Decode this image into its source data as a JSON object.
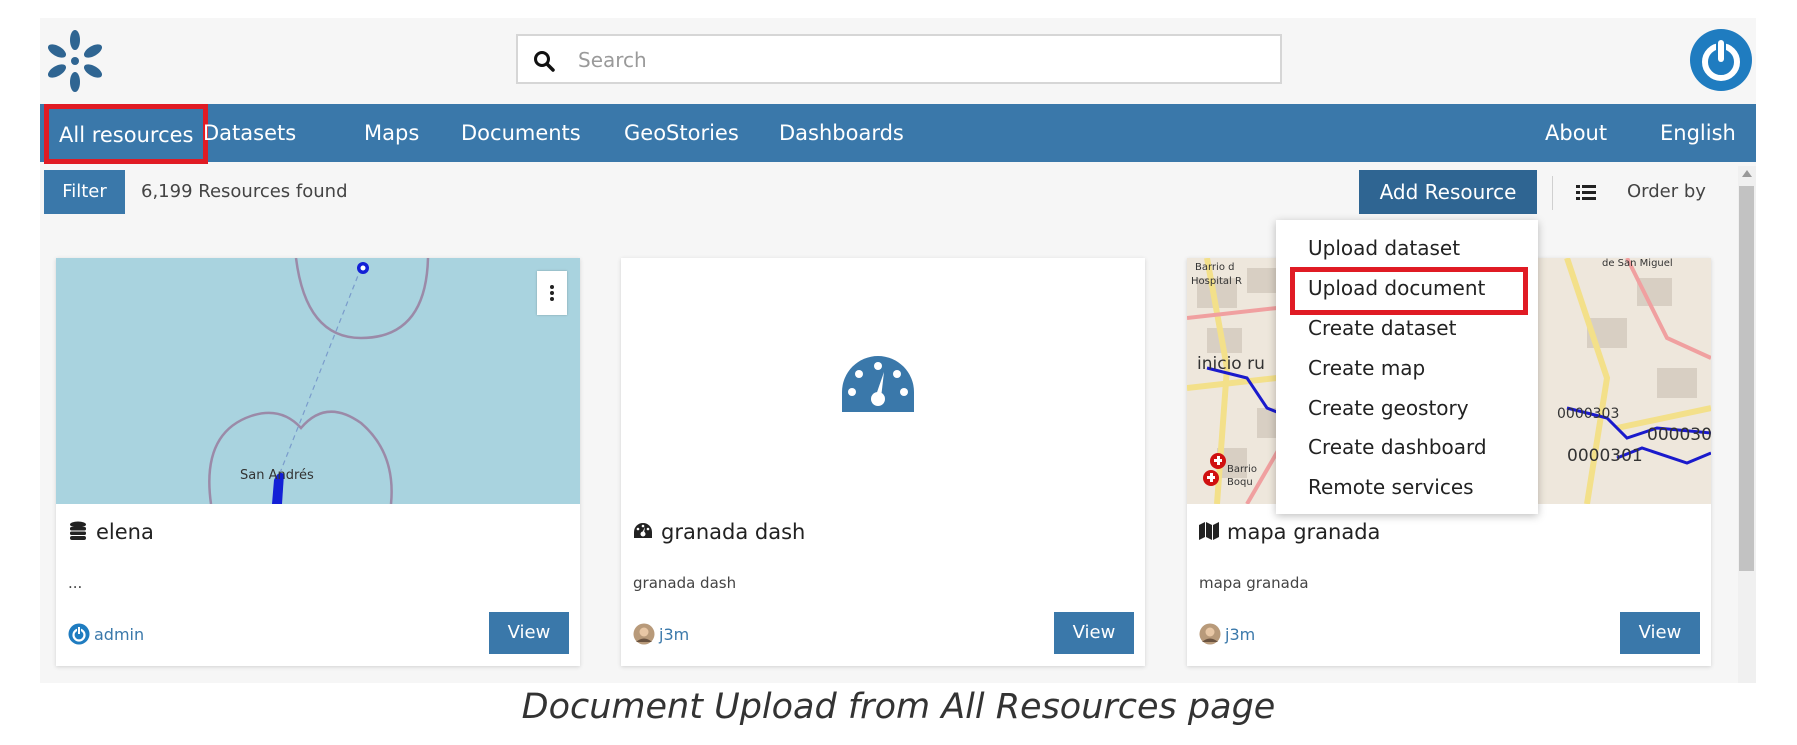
{
  "header": {
    "logo_icon": "geonode-logo-icon",
    "search": {
      "placeholder": "Search",
      "value": ""
    },
    "user_icon": "user-power-icon"
  },
  "nav": {
    "left": [
      "All resources",
      "Datasets",
      "Maps",
      "Documents",
      "GeoStories",
      "Dashboards"
    ],
    "right": [
      "About",
      "English"
    ],
    "active": "All resources"
  },
  "toolbar": {
    "filter_label": "Filter",
    "results_count": "6,199 Resources found",
    "add_resource_label": "Add Resource",
    "view_icon": "list-view-icon",
    "order_by_label": "Order by"
  },
  "add_menu": {
    "items": [
      "Upload dataset",
      "Upload document",
      "Create dataset",
      "Create map",
      "Create geostory",
      "Create dashboard",
      "Remote services"
    ],
    "highlighted": "Upload document"
  },
  "cards": [
    {
      "title": "elena",
      "type_icon": "database-icon",
      "description": "...",
      "owner": "admin",
      "view_label": "View"
    },
    {
      "title": "granada dash",
      "type_icon": "dashboard-icon",
      "description": "granada dash",
      "owner": "j3m",
      "view_label": "View"
    },
    {
      "title": "mapa granada",
      "type_icon": "map-icon",
      "description": "mapa granada",
      "owner": "j3m",
      "view_label": "View"
    }
  ],
  "map_labels": {
    "card1_place": "San Andrés",
    "card3_places": [
      "Barrio d",
      "Hospital R",
      "inicio ru",
      "Barrio",
      "Boqu",
      "de San Miguel"
    ],
    "card3_codes": [
      "0000303",
      "000030",
      "0000301"
    ]
  },
  "caption": "Document Upload from All Resources page",
  "colors": {
    "primary": "#3a78aa",
    "primary_dark": "#2f6592",
    "highlight": "#e01b24"
  }
}
